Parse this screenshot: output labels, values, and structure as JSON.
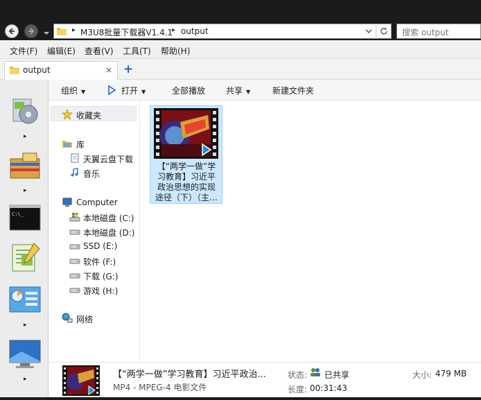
{
  "address": {
    "crumbs": [
      "M3U8批量下载器V1.4.1",
      "output"
    ],
    "search_placeholder": "搜索 output"
  },
  "menu": [
    "文件(F)",
    "编辑(E)",
    "查看(V)",
    "工具(T)",
    "帮助(H)"
  ],
  "tabs": [
    {
      "label": "output",
      "close": "×"
    }
  ],
  "tab_add": "+",
  "toolbar": {
    "organize": "组织",
    "open": "打开",
    "play_all": "全部播放",
    "share": "共享",
    "new_folder": "新建文件夹"
  },
  "nav": {
    "favorites": "收藏夹",
    "libraries": "库",
    "library_items": [
      "天翼云盘下载",
      "音乐"
    ],
    "computer": "Computer",
    "drives": [
      "本地磁盘 (C:)",
      "本地磁盘 (D:)",
      "SSD (E:)",
      "软件 (F:)",
      "下载 (G:)",
      "游戏 (H:)"
    ],
    "network": "网络"
  },
  "file": {
    "name_lines": [
      "【“两学一做”学",
      "习教育】习近平",
      "政治思想的实现",
      "途径（下）（主…"
    ]
  },
  "details": {
    "title": "【“两学一做”学习教育】习近平政治...",
    "type": "MP4 - MPEG-4 电影文件",
    "status_label": "状态:",
    "status_value": "已共享",
    "size_label": "大小:",
    "size_value": "479 MB",
    "length_label": "长度:",
    "length_value": "00:31:43"
  },
  "dock_icons": [
    "media-player-icon",
    "archive-icon",
    "terminal-icon",
    "notepad-icon",
    "control-panel-icon",
    "monitor-icon"
  ],
  "colors": {
    "window_dark": "#1b1b1b",
    "selection": "#cce8ff",
    "accent": "#1a63c6"
  }
}
